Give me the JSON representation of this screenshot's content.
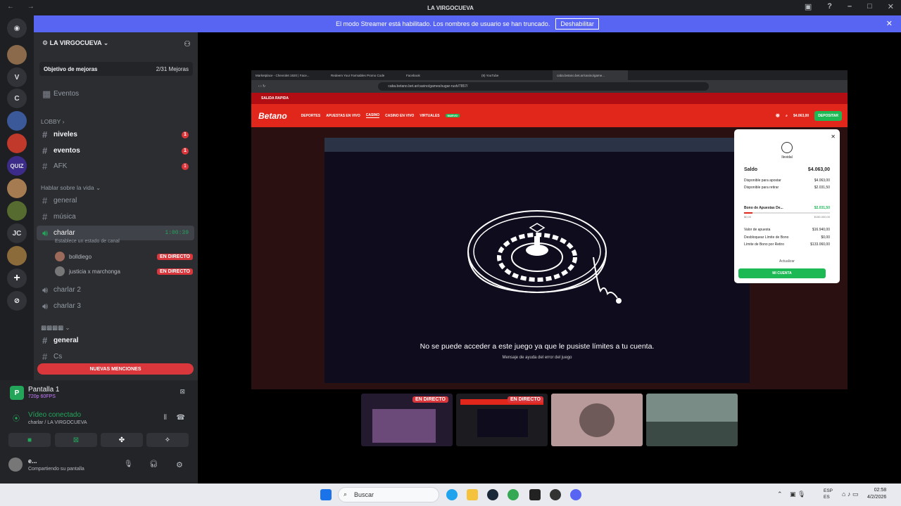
{
  "window": {
    "title": "LA VIRGOCUEVA"
  },
  "banner": {
    "text": "El modo Streamer está habilitado. Los nombres de usuario se han truncado.",
    "button": "Deshabilitar"
  },
  "server": {
    "name": "LA VIRGOCUEVA",
    "boost_label": "Objetivo de mejoras",
    "boost_count": "2/31 Mejoras"
  },
  "sidebar": {
    "events": "Eventos",
    "cat_lobby": "LOBBY",
    "ch_niveles": "niveles",
    "ch_eventos": "eventos",
    "ch_afk": "AFK",
    "badge_1": "1",
    "cat_hablar": "Hablar sobre la vida",
    "ch_general": "general",
    "ch_musica": "música",
    "ch_charlar": "charlar",
    "charlar_timer": "1:00:39",
    "charlar_status": "Establece un estado de canal",
    "user1": "bolldiego",
    "user2": "justicia x marchonga",
    "live": "EN DIRECTO",
    "ch_charlar2": "charlar 2",
    "ch_charlar3": "charlar 3",
    "ch_general2": "general",
    "ch_cs": "Cs",
    "new_mentions": "NUEVAS MENCIONES"
  },
  "voice": {
    "screen_title": "Pantalla 1",
    "screen_quality": "720p 60FPS",
    "connected": "Vídeo conectado",
    "location": "charlar / LA VIRGOCUEVA",
    "username": "e...",
    "user_status": "Compartiendo su pantalla"
  },
  "browser": {
    "tabs": [
      "Marketplace - Chevrolet 1920 | Face...",
      "Redeem Your Farmables Promo Code",
      "Facebook",
      "(9) YouTube",
      "caba.betano.bet.ar/casino/game..."
    ],
    "url": "caba.betano.bet.ar/casino/games/sugar-rush/7857/"
  },
  "betano": {
    "quick_exit": "SALIDA RAPIDA",
    "logo": "Betano",
    "nav": [
      "DEPORTES",
      "APUESTAS EN VIVO",
      "CASINO",
      "CASINO EN VIVO",
      "VIRTUALES"
    ],
    "new_badge": "NUEVO",
    "balance": "$4.063,00",
    "deposit": "DEPOSITAR",
    "error_msg": "No se puede acceder a este juego ya que le pusiste límites a tu cuenta.",
    "help_link": "Mensaje de ayuda del error del juego"
  },
  "wallet": {
    "user": "Ilevidal",
    "saldo_label": "Saldo",
    "saldo": "$4.063,00",
    "disponible_apostar_label": "Disponible para apostar",
    "disponible_apostar": "$4.063,00",
    "disponible_retirar_label": "Disponible para retirar",
    "disponible_retirar": "$2.031,50",
    "bono_label": "Bono de Apuestas De...",
    "bono": "$2.031,50",
    "bono_min": "$0,00",
    "bono_max": "$150.000,00",
    "valor_label": "Valor de apuesta",
    "valor": "$16.940,00",
    "desbloquear_label": "Desbloquear Límite de Bono",
    "desbloquear": "$0,00",
    "limite_label": "Límite de Bono por Retiro",
    "limite": "$133.060,00",
    "update": "Actualizar",
    "account_button": "MI CUENTA"
  },
  "thumbs": {
    "live": "EN DIRECTO"
  },
  "taskbar": {
    "search": "Buscar",
    "lang": "ESP",
    "lang2": "ES",
    "time": "02:58",
    "date": "4/2/2026"
  }
}
